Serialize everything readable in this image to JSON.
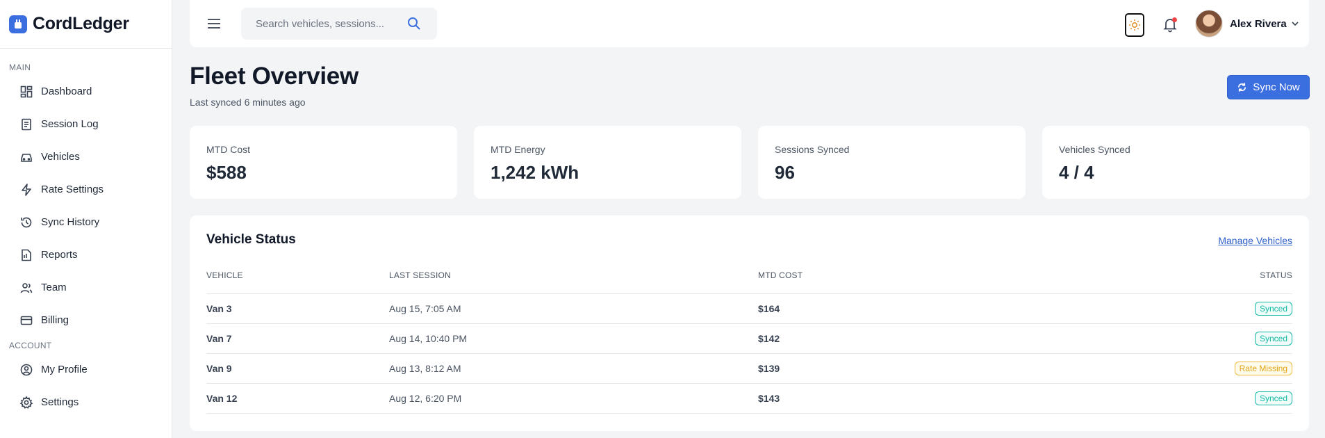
{
  "brand": {
    "name": "CordLedger"
  },
  "sidebar": {
    "sections": [
      {
        "label": "MAIN",
        "items": [
          {
            "label": "Dashboard",
            "icon": "dashboard-icon"
          },
          {
            "label": "Session Log",
            "icon": "session-log-icon"
          },
          {
            "label": "Vehicles",
            "icon": "car-icon"
          },
          {
            "label": "Rate Settings",
            "icon": "bolt-icon"
          },
          {
            "label": "Sync History",
            "icon": "history-icon"
          },
          {
            "label": "Reports",
            "icon": "report-icon"
          },
          {
            "label": "Team",
            "icon": "team-icon"
          },
          {
            "label": "Billing",
            "icon": "credit-card-icon"
          }
        ]
      },
      {
        "label": "ACCOUNT",
        "items": [
          {
            "label": "My Profile",
            "icon": "user-circle-icon"
          },
          {
            "label": "Settings",
            "icon": "gear-icon"
          }
        ]
      }
    ]
  },
  "topbar": {
    "search_placeholder": "Search vehicles, sessions...",
    "user_name": "Alex Rivera"
  },
  "header": {
    "title": "Fleet Overview",
    "subtitle": "Last synced 6 minutes ago",
    "sync_label": "Sync Now"
  },
  "stats": [
    {
      "label": "MTD Cost",
      "value": "$588"
    },
    {
      "label": "MTD Energy",
      "value": "1,242 kWh"
    },
    {
      "label": "Sessions Synced",
      "value": "96"
    },
    {
      "label": "Vehicles Synced",
      "value": "4 / 4"
    }
  ],
  "vehicle_status": {
    "title": "Vehicle Status",
    "manage_link": "Manage Vehicles",
    "columns": [
      "VEHICLE",
      "LAST SESSION",
      "MTD COST",
      "STATUS"
    ],
    "rows": [
      {
        "vehicle": "Van 3",
        "last_session": "Aug 15, 7:05 AM",
        "mtd_cost": "$164",
        "status": "Synced"
      },
      {
        "vehicle": "Van 7",
        "last_session": "Aug 14, 10:40 PM",
        "mtd_cost": "$142",
        "status": "Synced"
      },
      {
        "vehicle": "Van 9",
        "last_session": "Aug 13, 8:12 AM",
        "mtd_cost": "$139",
        "status": "Rate Missing"
      },
      {
        "vehicle": "Van 12",
        "last_session": "Aug 12, 6:20 PM",
        "mtd_cost": "$143",
        "status": "Synced"
      }
    ]
  },
  "colors": {
    "accent": "#3b6fe0",
    "synced": "#14b8a6",
    "rate_missing": "#e0a414",
    "notification_dot": "#ef4444"
  }
}
